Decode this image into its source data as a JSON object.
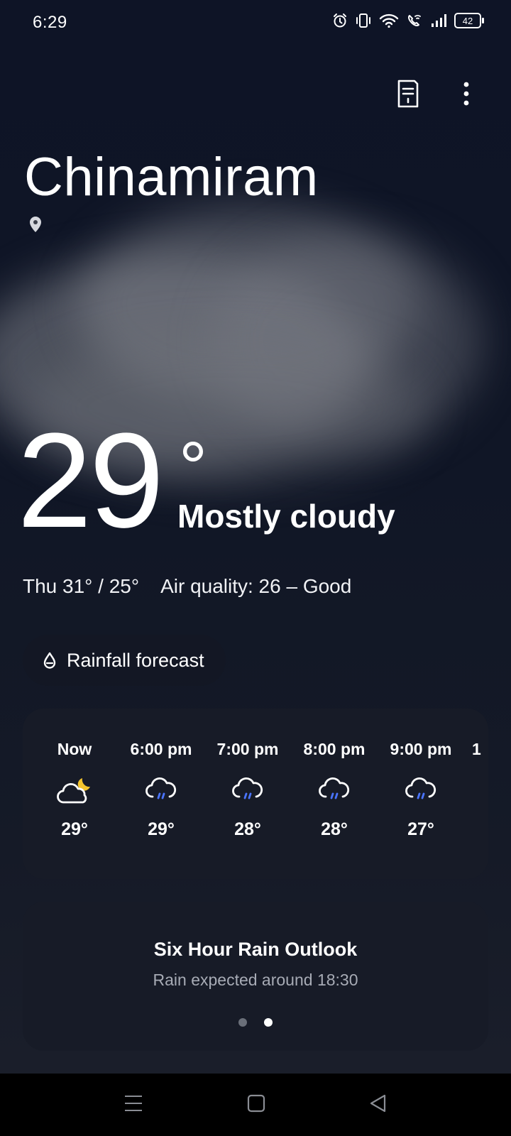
{
  "status_bar": {
    "time": "6:29",
    "battery": "42",
    "icons": [
      "alarm-icon",
      "vibrate-icon",
      "wifi-icon",
      "wifi-calling-icon",
      "signal-icon",
      "battery-icon"
    ]
  },
  "location": {
    "city": "Chinamiram"
  },
  "current": {
    "temperature": "29",
    "degree_symbol": "°",
    "condition": "Mostly cloudy",
    "day_range": "Thu 31° / 25°",
    "air_quality": "Air quality: 26 – Good"
  },
  "rainfall_chip": {
    "label": "Rainfall forecast"
  },
  "hourly": [
    {
      "time": "Now",
      "icon": "partly-cloudy-night-icon",
      "temp": "29°"
    },
    {
      "time": "6:00 pm",
      "icon": "rain-cloud-icon",
      "temp": "29°"
    },
    {
      "time": "7:00 pm",
      "icon": "rain-cloud-icon",
      "temp": "28°"
    },
    {
      "time": "8:00 pm",
      "icon": "rain-cloud-icon",
      "temp": "28°"
    },
    {
      "time": "9:00 pm",
      "icon": "rain-cloud-icon",
      "temp": "27°"
    },
    {
      "time": "1",
      "icon": "",
      "temp": ""
    }
  ],
  "outlook": {
    "title": "Six Hour Rain Outlook",
    "subtitle": "Rain expected around 18:30",
    "pages": 2,
    "active_page": 2
  },
  "colors": {
    "background": "#101626",
    "card": "#171b27",
    "moon": "#f5c52e",
    "rain": "#4a74ff",
    "muted_text": "#a7abb5"
  }
}
